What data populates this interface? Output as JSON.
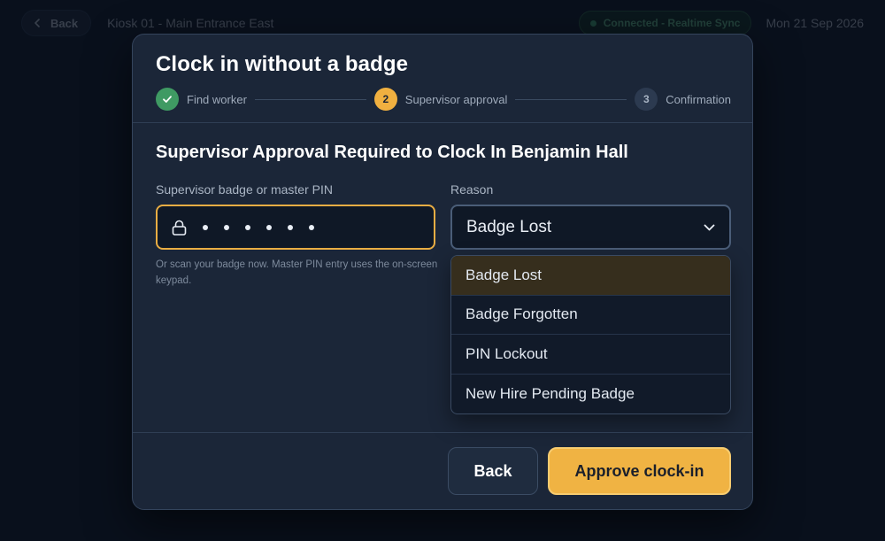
{
  "topbar": {
    "back_label": "Back",
    "kiosk_name": "Kiosk 01 - Main Entrance East",
    "connection_status": "Connected - Realtime Sync",
    "date": "Mon 21 Sep 2026"
  },
  "modal": {
    "title": "Clock in without a badge",
    "steps": [
      {
        "number": "1",
        "label": "Find worker",
        "state": "done"
      },
      {
        "number": "2",
        "label": "Supervisor approval",
        "state": "active"
      },
      {
        "number": "3",
        "label": "Confirmation",
        "state": "todo"
      }
    ],
    "heading": "Supervisor Approval Required to Clock In Benjamin Hall",
    "pin_label": "Supervisor badge or master PIN",
    "pin_masked_length": 6,
    "helper_text": "Or scan your badge now. Master PIN entry uses the on-screen keypad.",
    "reason_label": "Reason",
    "reason_selected": "Badge Lost",
    "reason_options": [
      "Badge Lost",
      "Badge Forgotten",
      "PIN Lockout",
      "New Hire Pending Badge"
    ],
    "back_button": "Back",
    "approve_button": "Approve clock-in"
  },
  "colors": {
    "accent": "#f0b343",
    "success": "#3f9a63",
    "background": "#0b1422",
    "modal": "#1b2638"
  },
  "icons": {
    "back": "chevron-left-icon",
    "done_step": "check-icon",
    "pin": "lock-icon",
    "select": "chevron-down-icon",
    "status": "status-dot-icon"
  }
}
